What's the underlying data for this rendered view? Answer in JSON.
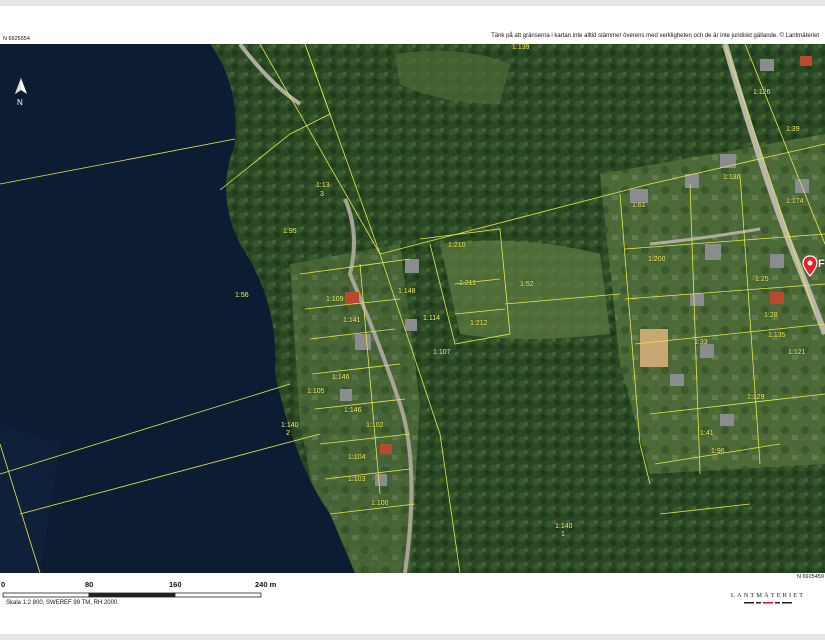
{
  "header": {
    "coord_top": "N 6925654",
    "notice": "Tänk på att gränserna i kartan inte alltid stämmer överens med verkligheten och de är inte juridiskt gällande. © Lantmäteriet"
  },
  "footer": {
    "coord_bottom": "N 6925459",
    "scale_ticks": [
      "0",
      "80",
      "160",
      "240  m"
    ],
    "scale_text": "Skala 1:2 800, SWEREF 99 TM, RH 2000.",
    "logo": "LANTMÄTERIET"
  },
  "map": {
    "marker_label": "F",
    "parcels": [
      "1:139",
      "1:13",
      "3",
      "1:95",
      "1:56",
      "1:210",
      "1:211",
      "1:52",
      "1:212",
      "1:140",
      "2",
      "1:140",
      "1",
      "1:200",
      "1:174",
      "1:126",
      "1:39",
      "1:136",
      "1:61",
      "1:33",
      "1:28",
      "1:41",
      "1:96",
      "1:148",
      "1:114",
      "1:107",
      "1:141",
      "1:146",
      "1:102",
      "1:104",
      "1:103",
      "1:100",
      "1:146",
      "1:105",
      "1:109",
      "1:121",
      "1:129",
      "1:135",
      "1:25"
    ],
    "colors": {
      "water": "#0c1c33",
      "forest": "#2b4a25",
      "boundary": "#e8e84a",
      "marker": "#e8212e"
    }
  }
}
